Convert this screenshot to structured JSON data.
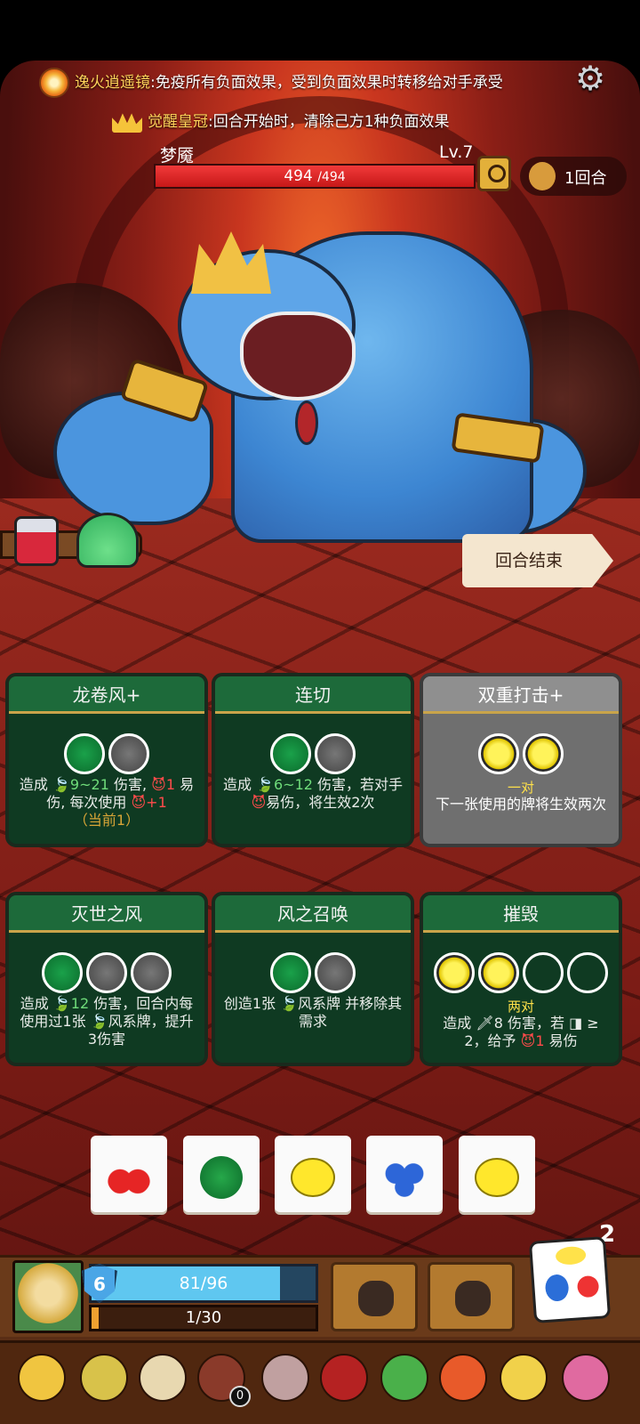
{
  "buffs": [
    {
      "name": "逸火逍遥镜",
      "desc": "免疫所有负面效果，受到负面效果时转移给对手承受"
    },
    {
      "name": "觉醒皇冠",
      "desc": "回合开始时，清除己方1种负面效果"
    }
  ],
  "enemy": {
    "name": "梦魇",
    "level": "Lv.7",
    "hp_current": "494",
    "hp_max": "/494",
    "hp_fraction": 1.0
  },
  "turn": {
    "label": "1回合"
  },
  "end_turn_label": "回合结束",
  "cards": [
    {
      "title": "龙卷风+",
      "style": "green",
      "slots": [
        "green",
        "gray"
      ],
      "desc_parts": [
        {
          "t": "造成 ",
          "c": ""
        },
        {
          "t": "🍃9~21",
          "c": "hl"
        },
        {
          "t": " 伤害, ",
          "c": ""
        },
        {
          "t": "😈1",
          "c": "red"
        },
        {
          "t": " 易伤, 每次使用 ",
          "c": ""
        },
        {
          "t": "😈+1",
          "c": "red"
        },
        {
          "t": "（当前1）",
          "c": "gold"
        }
      ]
    },
    {
      "title": "连切",
      "style": "green",
      "slots": [
        "green",
        "gray"
      ],
      "desc_parts": [
        {
          "t": "造成 ",
          "c": ""
        },
        {
          "t": "🍃6~12",
          "c": "hl"
        },
        {
          "t": " 伤害，若对手 ",
          "c": ""
        },
        {
          "t": "😈",
          "c": "red"
        },
        {
          "t": "易伤，将生效2次",
          "c": ""
        }
      ]
    },
    {
      "title": "双重打击+",
      "style": "gray",
      "slots": [
        "lemon",
        "lemon"
      ],
      "pair": "一对",
      "desc_parts": [
        {
          "t": "下一张使用的牌将生效两次",
          "c": ""
        }
      ]
    },
    {
      "title": "灭世之风",
      "style": "green",
      "slots": [
        "green",
        "gray",
        "gray"
      ],
      "desc_parts": [
        {
          "t": "造成 ",
          "c": ""
        },
        {
          "t": "🍃12",
          "c": "hl"
        },
        {
          "t": " 伤害，回合内每使用过1张 ",
          "c": ""
        },
        {
          "t": "🍃",
          "c": "hl"
        },
        {
          "t": "风系牌，提升3伤害",
          "c": ""
        }
      ]
    },
    {
      "title": "风之召唤",
      "style": "green",
      "slots": [
        "green",
        "gray"
      ],
      "desc_parts": [
        {
          "t": "创造1张 ",
          "c": ""
        },
        {
          "t": "🍃",
          "c": "hl"
        },
        {
          "t": "风系牌 并移除其需求",
          "c": ""
        }
      ]
    },
    {
      "title": "摧毁",
      "style": "green",
      "slots": [
        "lemon",
        "lemon",
        "empty",
        "empty"
      ],
      "pair": "两对",
      "desc_parts": [
        {
          "t": "造成 ",
          "c": ""
        },
        {
          "t": "🗡8",
          "c": ""
        },
        {
          "t": " 伤害，若 ",
          "c": ""
        },
        {
          "t": "◨",
          "c": ""
        },
        {
          "t": " ≥ 2，给予 ",
          "c": ""
        },
        {
          "t": "😈1",
          "c": "red"
        },
        {
          "t": " 易伤",
          "c": ""
        }
      ]
    }
  ],
  "dice": [
    "cherry",
    "watermelon",
    "lemon",
    "blueberry",
    "lemon"
  ],
  "player": {
    "shield": "6",
    "hp_text": "81/96",
    "hp_fraction": 0.84,
    "xp_text": "1/30",
    "xp_fraction": 0.033
  },
  "dice_remaining": "2",
  "relic_badge": "0",
  "colors": {
    "accent_gold": "#ffd35a",
    "hp_red": "#e02424",
    "card_green": "#0f3a22",
    "player_hp": "#5fc7f0"
  }
}
